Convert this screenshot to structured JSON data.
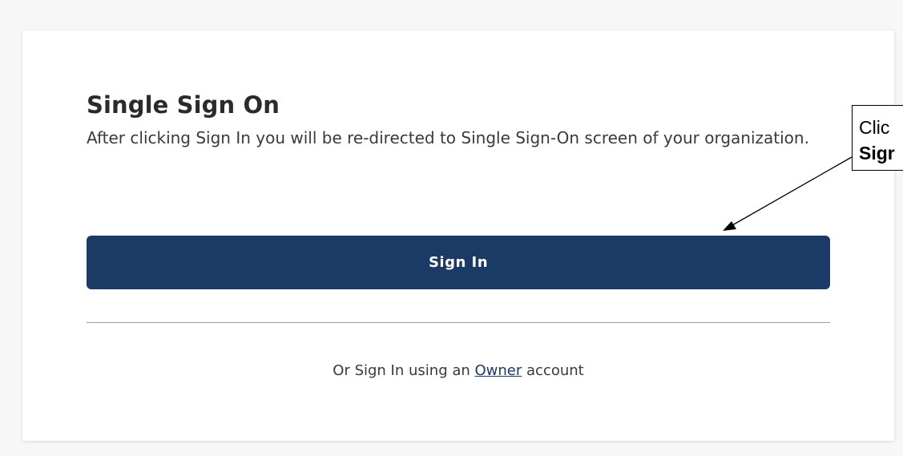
{
  "card": {
    "title": "Single Sign On",
    "description": "After clicking Sign In you will be re-directed to Single Sign-On screen of your organization.",
    "signin_button_label": "Sign In",
    "alt_prefix": "Or Sign In using an ",
    "alt_link": "Owner",
    "alt_suffix": " account"
  },
  "callout": {
    "line1": "Clic",
    "line2": "Sigr"
  },
  "colors": {
    "button_bg": "#1c3a66",
    "link": "#1c3a66",
    "page_bg": "#f7f7f7"
  }
}
